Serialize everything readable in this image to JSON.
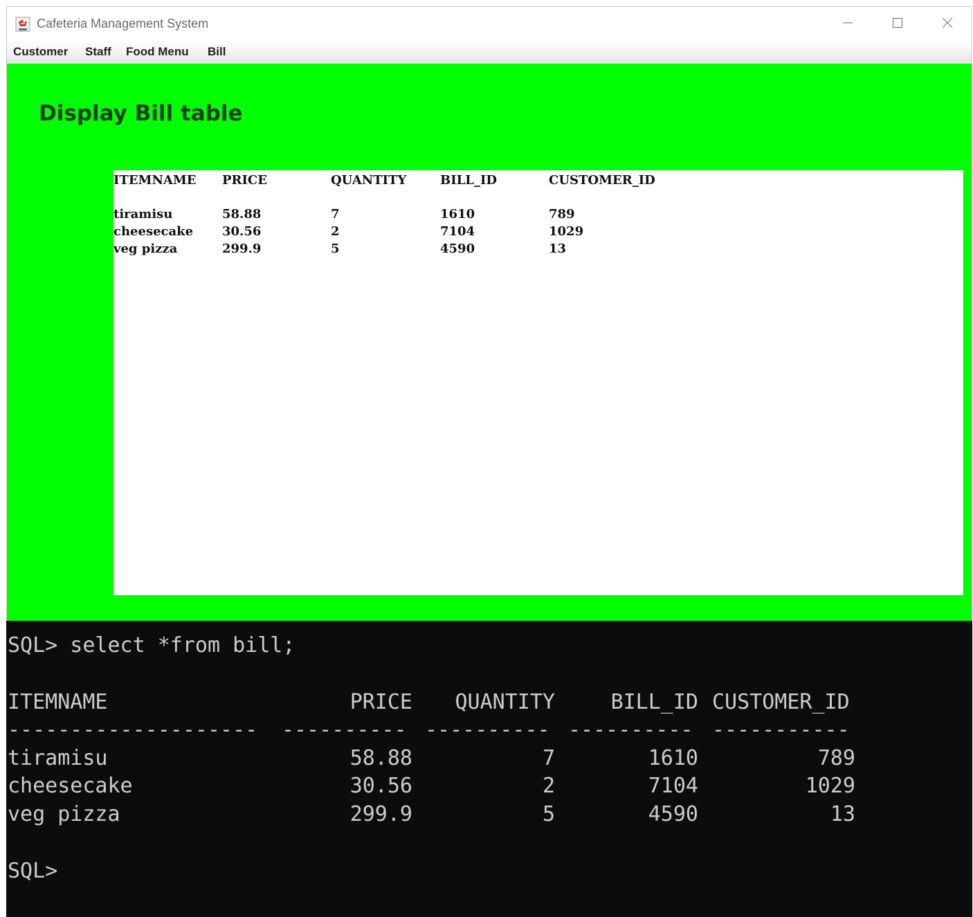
{
  "window": {
    "title": "Cafeteria Management System"
  },
  "menu": [
    "Customer",
    "Staff",
    "Food Menu",
    "Bill"
  ],
  "page": {
    "heading": "Display Bill table"
  },
  "bill_table": {
    "headers": [
      "ITEMNAME",
      "PRICE",
      "QUANTITY",
      "BILL_ID",
      "CUSTOMER_ID"
    ],
    "rows": [
      [
        "tiramisu",
        "58.88",
        "7",
        "1610",
        "789"
      ],
      [
        "cheesecake",
        "30.56",
        "2",
        "7104",
        "1029"
      ],
      [
        "veg pizza",
        "299.9",
        "5",
        "4590",
        "13"
      ]
    ]
  },
  "console": {
    "command": "SQL> select *from bill;",
    "headers": [
      "ITEMNAME",
      "PRICE",
      "QUANTITY",
      "BILL_ID",
      "CUSTOMER_ID"
    ],
    "dashes": [
      "--------------------",
      "----------",
      "----------",
      "----------",
      "-----------"
    ],
    "rows": [
      [
        "tiramisu",
        "58.88",
        "7",
        "1610",
        "789"
      ],
      [
        "cheesecake",
        "30.56",
        "2",
        "7104",
        "1029"
      ],
      [
        "veg pizza",
        "299.9",
        "5",
        "4590",
        "13"
      ]
    ],
    "prompt": "SQL>"
  },
  "colors": {
    "content_background": "#00ff00",
    "console_background": "#0c0c0c",
    "console_text": "#cccccc"
  },
  "icons": {
    "app": "java-coffee-cup-icon",
    "minimize": "minimize-icon",
    "maximize": "maximize-icon",
    "close": "close-icon"
  }
}
